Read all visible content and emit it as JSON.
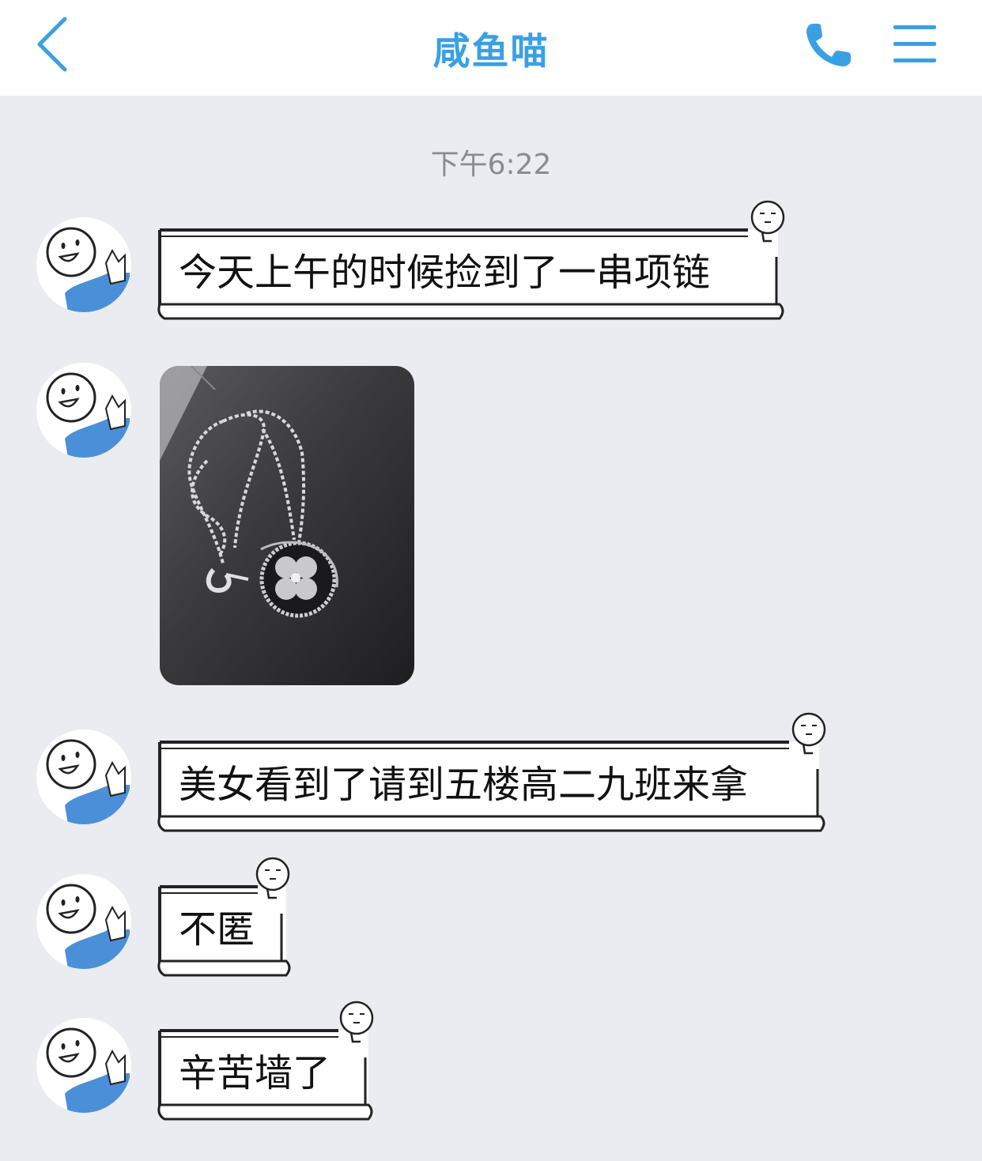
{
  "header": {
    "title": "咸鱼喵",
    "accent_color": "#3aa0e4",
    "back_icon": "chevron-left-icon",
    "call_icon": "phone-icon",
    "menu_icon": "menu-icon"
  },
  "chat": {
    "timestamp": "下午6:22",
    "messages": [
      {
        "type": "text",
        "text": "今天上午的时候捡到了一串项链"
      },
      {
        "type": "image",
        "image_alt": "silver necklace with flower pendant on dark surface"
      },
      {
        "type": "text",
        "text": "美女看到了请到五楼高二九班来拿"
      },
      {
        "type": "text",
        "text": "不匿"
      },
      {
        "type": "text",
        "text": "辛苦墙了"
      }
    ]
  }
}
